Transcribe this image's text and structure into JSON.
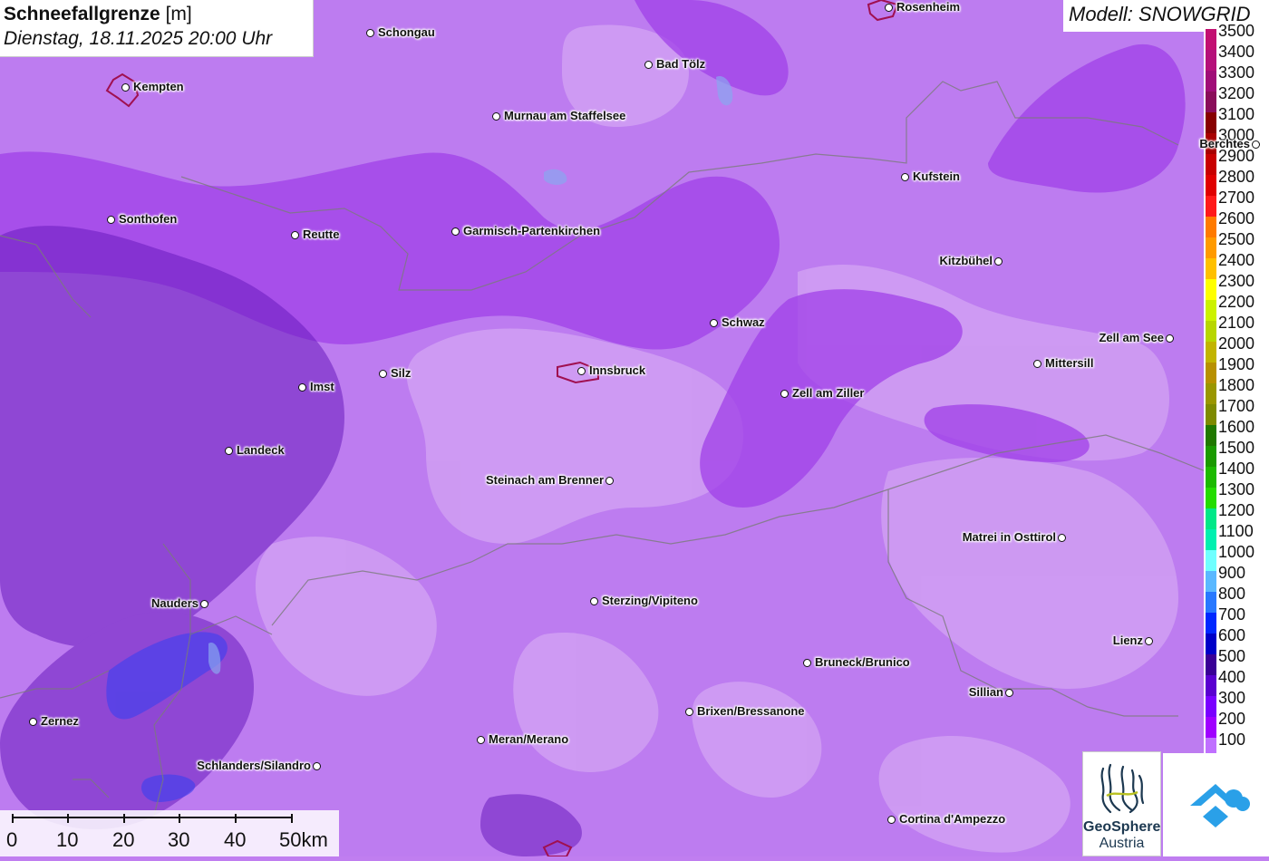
{
  "header": {
    "title_bold": "Schneefallgrenze",
    "title_unit": "[m]",
    "datetime": "Dienstag, 18.11.2025 20:00 Uhr"
  },
  "model_label": "Modell: SNOWGRID",
  "legend": {
    "entries": [
      {
        "label": "3500",
        "color": "#c21072"
      },
      {
        "label": "3400",
        "color": "#b5107a"
      },
      {
        "label": "3300",
        "color": "#a00d78"
      },
      {
        "label": "3200",
        "color": "#8a0d5a"
      },
      {
        "label": "3100",
        "color": "#870000"
      },
      {
        "label": "3000",
        "color": "#a80000"
      },
      {
        "label": "2900",
        "color": "#c80000"
      },
      {
        "label": "2800",
        "color": "#e00000"
      },
      {
        "label": "2700",
        "color": "#ff1a1a"
      },
      {
        "label": "2600",
        "color": "#ff7a00"
      },
      {
        "label": "2500",
        "color": "#ff9a00"
      },
      {
        "label": "2400",
        "color": "#ffc000"
      },
      {
        "label": "2300",
        "color": "#ffff00"
      },
      {
        "label": "2200",
        "color": "#ccf200"
      },
      {
        "label": "2100",
        "color": "#b8d600"
      },
      {
        "label": "2000",
        "color": "#c2b400"
      },
      {
        "label": "1900",
        "color": "#b89000"
      },
      {
        "label": "1800",
        "color": "#9a9600"
      },
      {
        "label": "1700",
        "color": "#7e8a00"
      },
      {
        "label": "1600",
        "color": "#207800"
      },
      {
        "label": "1500",
        "color": "#1a9a00"
      },
      {
        "label": "1400",
        "color": "#1cba00"
      },
      {
        "label": "1300",
        "color": "#24dc00"
      },
      {
        "label": "1200",
        "color": "#00e888"
      },
      {
        "label": "1100",
        "color": "#00f0b0"
      },
      {
        "label": "1000",
        "color": "#70ffff"
      },
      {
        "label": "900",
        "color": "#5ab8ff"
      },
      {
        "label": "800",
        "color": "#2878ff"
      },
      {
        "label": "700",
        "color": "#0028ff"
      },
      {
        "label": "600",
        "color": "#0000c8"
      },
      {
        "label": "500",
        "color": "#3a0096"
      },
      {
        "label": "400",
        "color": "#5a00d0"
      },
      {
        "label": "300",
        "color": "#7a00ff"
      },
      {
        "label": "200",
        "color": "#a000ff"
      },
      {
        "label": "100",
        "color": "#c070ff"
      }
    ]
  },
  "cities": [
    {
      "name": "Rosenheim",
      "label_side": "right"
    },
    {
      "name": "Schongau",
      "label_side": "right"
    },
    {
      "name": "Kempten",
      "label_side": "right"
    },
    {
      "name": "Bad Tölz",
      "label_side": "right"
    },
    {
      "name": "Murnau am Staffelsee",
      "label_side": "right"
    },
    {
      "name": "Berchtes",
      "label_side": "left"
    },
    {
      "name": "Kufstein",
      "label_side": "right"
    },
    {
      "name": "Sonthofen",
      "label_side": "right"
    },
    {
      "name": "Reutte",
      "label_side": "right"
    },
    {
      "name": "Garmisch-Partenkirchen",
      "label_side": "right"
    },
    {
      "name": "Kitzbühel",
      "label_side": "left"
    },
    {
      "name": "Schwaz",
      "label_side": "right"
    },
    {
      "name": "Zell am See",
      "label_side": "left"
    },
    {
      "name": "Mittersill",
      "label_side": "right"
    },
    {
      "name": "Innsbruck",
      "label_side": "right"
    },
    {
      "name": "Silz",
      "label_side": "right"
    },
    {
      "name": "Imst",
      "label_side": "right"
    },
    {
      "name": "Zell am Ziller",
      "label_side": "right"
    },
    {
      "name": "Landeck",
      "label_side": "right"
    },
    {
      "name": "Steinach am Brenner",
      "label_side": "left"
    },
    {
      "name": "Matrei in Osttirol",
      "label_side": "left"
    },
    {
      "name": "Nauders",
      "label_side": "left"
    },
    {
      "name": "Sterzing/Vipiteno",
      "label_side": "right"
    },
    {
      "name": "Lienz",
      "label_side": "left"
    },
    {
      "name": "Bruneck/Brunico",
      "label_side": "right"
    },
    {
      "name": "Sillian",
      "label_side": "left"
    },
    {
      "name": "Brixen/Bressanone",
      "label_side": "right"
    },
    {
      "name": "Zernez",
      "label_side": "right"
    },
    {
      "name": "Meran/Merano",
      "label_side": "right"
    },
    {
      "name": "Schlanders/Silandro",
      "label_side": "left"
    },
    {
      "name": "Cortina d'Ampezzo",
      "label_side": "right"
    }
  ],
  "scalebar": {
    "labels": [
      "0",
      "10",
      "20",
      "30",
      "40",
      "50km"
    ]
  },
  "logos": {
    "geosphere_line1": "GeoSphere",
    "geosphere_line2": "Austria"
  }
}
